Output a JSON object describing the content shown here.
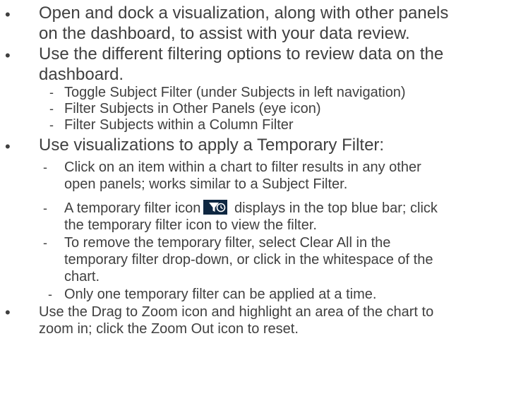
{
  "items": [
    {
      "lines": [
        "Open and dock a visualization, along with other panels",
        "on the dashboard, to assist with your data review."
      ]
    },
    {
      "lines": [
        "Use the different filtering options to review data on the",
        "dashboard."
      ],
      "sub": [
        "Toggle Subject Filter (under Subjects in left navigation)",
        "Filter Subjects in Other Panels (eye icon)",
        "Filter Subjects within a Column Filter"
      ]
    },
    {
      "lines": [
        "Use visualizations to apply a Temporary Filter:"
      ],
      "sub": [
        [
          "Click on an item within a chart to filter results in any other",
          "open panels; works similar to a Subject Filter."
        ],
        [
          "A temporary filter icon",
          "displays in the top blue bar; click",
          "the temporary filter icon to view the filter."
        ],
        [
          "To remove the temporary filter, select Clear All in the",
          "temporary filter drop-down, or click in the whitespace of the",
          "chart."
        ],
        [
          "Only one temporary filter can be applied at a time."
        ]
      ]
    },
    {
      "lines": [
        "Use the Drag to Zoom icon and highlight an area of the chart to",
        "zoom in; click the Zoom Out icon to reset."
      ]
    }
  ],
  "symbols": {
    "bullet": "•",
    "dash": "-"
  },
  "colors": {
    "text": "#404040",
    "icon_bg": "#0f2741"
  },
  "icons": {
    "temporary_filter": "filter-clock-icon"
  }
}
